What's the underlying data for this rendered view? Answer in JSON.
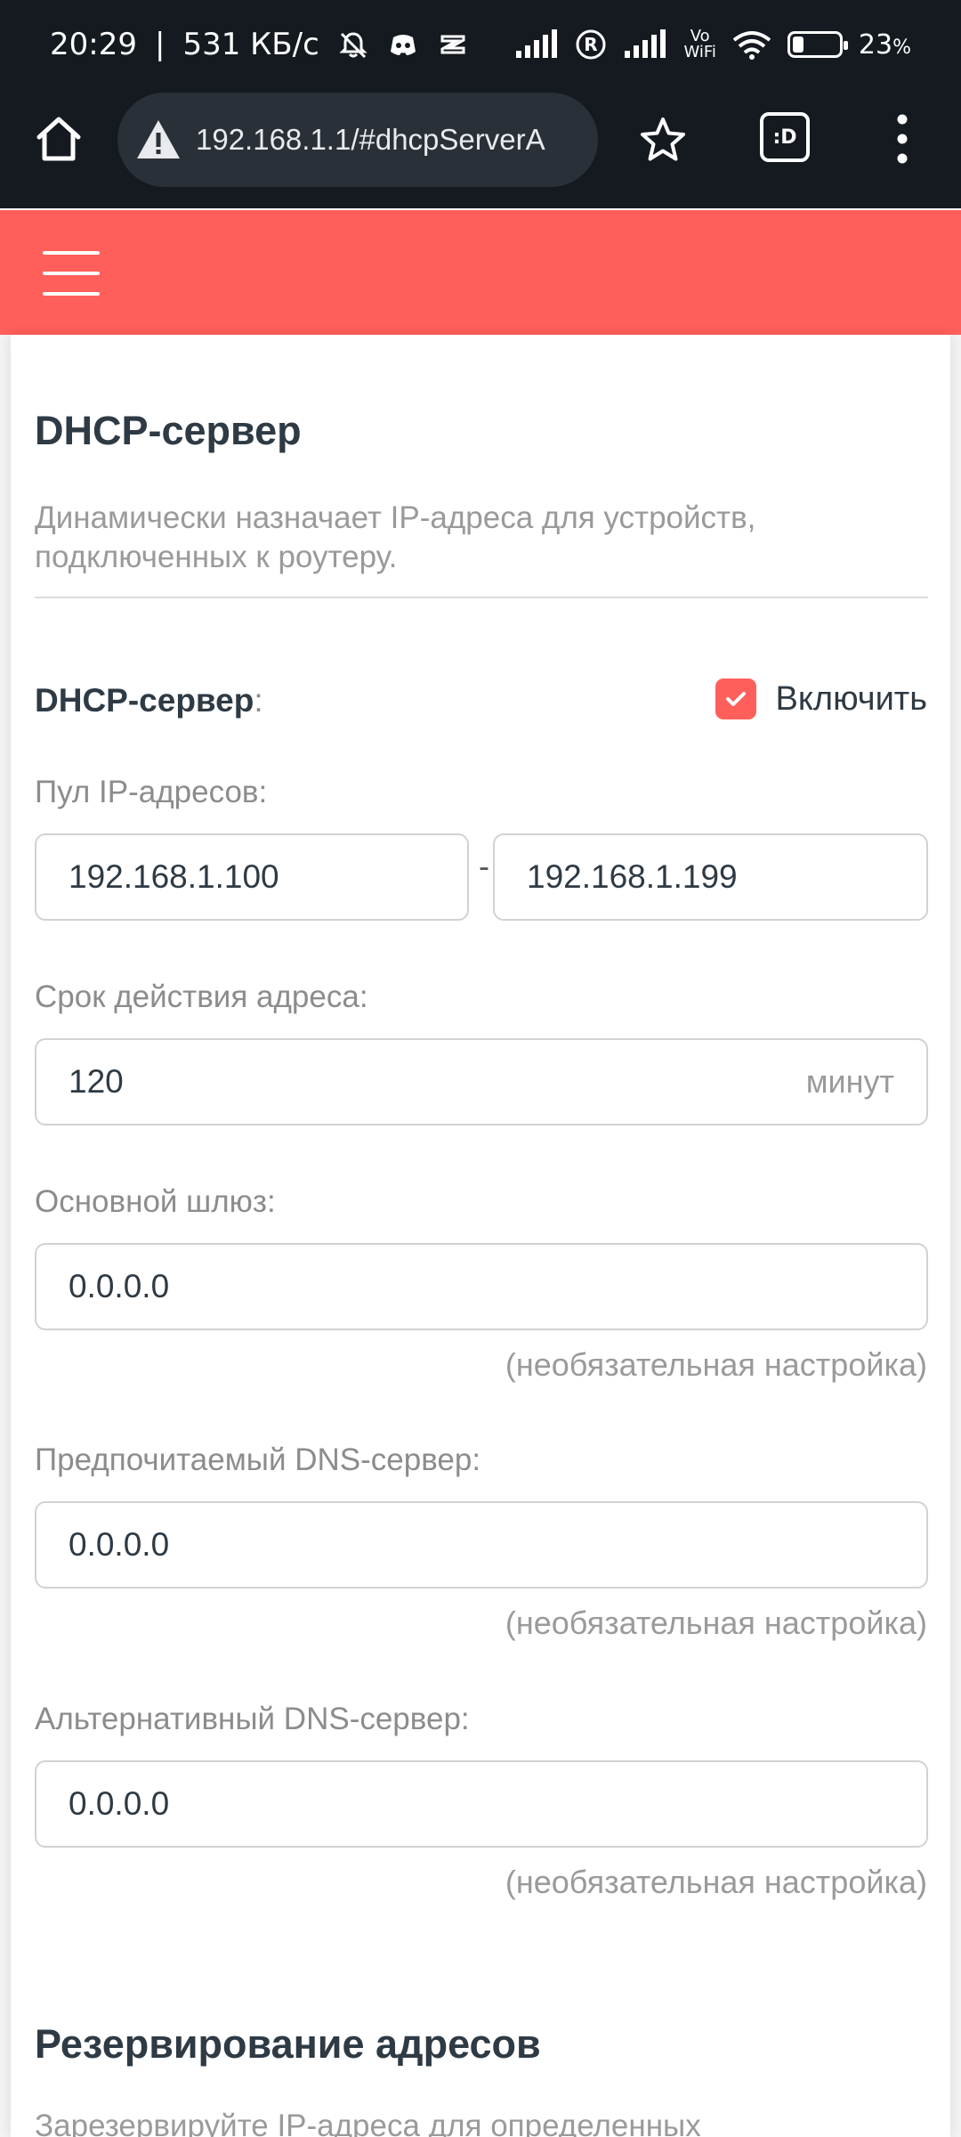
{
  "status_bar": {
    "time": "20:29",
    "speed": "531 КБ/с",
    "volte": "Vo\nWiFi",
    "battery_percent": "23",
    "battery_level": 0.23
  },
  "browser": {
    "url": "192.168.1.1/#dhcpServerA",
    "tabs_badge": ":D"
  },
  "colors": {
    "accent": "#ff5f5b",
    "dark_bar": "#141a20",
    "text_dark": "#2e3a44",
    "text_muted": "#9a9a9a"
  },
  "page": {
    "title": "DHCP-сервер",
    "description": "Динамически назначает IP-адреса для устройств, подключенных к роутеру.",
    "dhcp_server": {
      "label": "DHCP-сервер",
      "checkbox_label": "Включить",
      "enabled": true
    },
    "ip_pool": {
      "label": "Пул IP-адресов:",
      "start": "192.168.1.100",
      "separator": "-",
      "end": "192.168.1.199"
    },
    "lease": {
      "label": "Срок действия адреса:",
      "value": "120",
      "unit": "минут"
    },
    "gateway": {
      "label": "Основной шлюз:",
      "value": "0.0.0.0",
      "hint": "(необязательная настройка)"
    },
    "dns_primary": {
      "label": "Предпочитаемый DNS-сервер:",
      "value": "0.0.0.0",
      "hint": "(необязательная настройка)"
    },
    "dns_secondary": {
      "label": "Альтернативный DNS-сервер:",
      "value": "0.0.0.0",
      "hint": "(необязательная настройка)"
    },
    "reservation": {
      "title": "Резервирование адресов",
      "description_partial": "Зарезервируйте IP-адреса для определенных"
    }
  }
}
